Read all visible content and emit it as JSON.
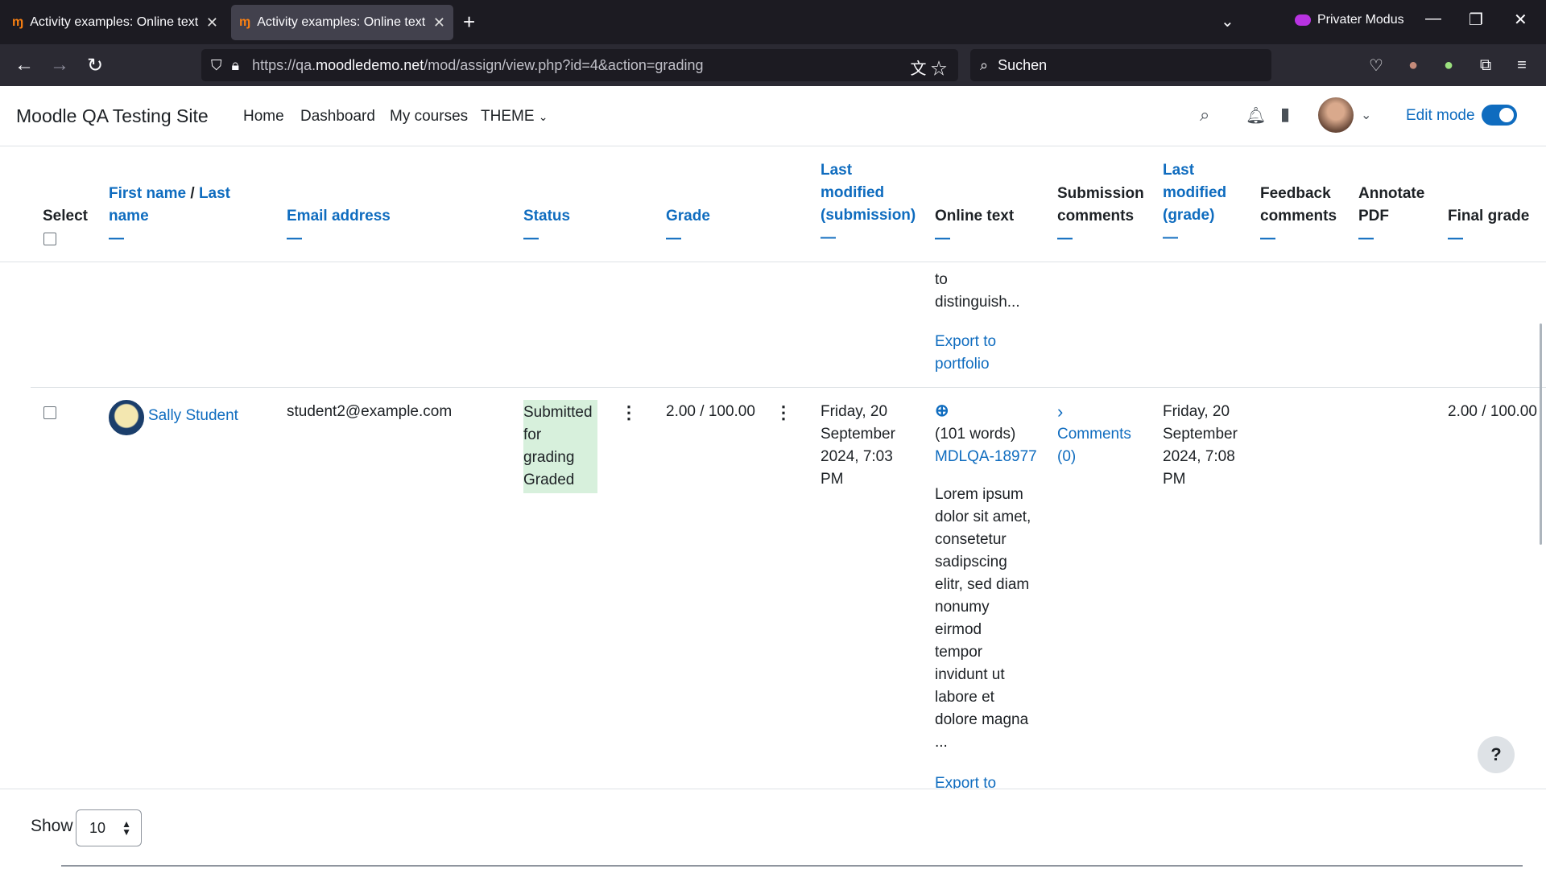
{
  "browser": {
    "tabs": [
      {
        "title": "Activity examples: Online text a",
        "active": false
      },
      {
        "title": "Activity examples: Online text a",
        "active": true
      }
    ],
    "new_tab": "+",
    "private_label": "Privater Modus",
    "url_prefix": "https://qa.",
    "url_domain": "moodledemo.net",
    "url_path": "/mod/assign/view.php?id=4&action=grading",
    "search_placeholder": "Suchen"
  },
  "moodle": {
    "site_name": "Moodle QA Testing Site",
    "nav": [
      "Home",
      "Dashboard",
      "My courses",
      "THEME"
    ],
    "edit_mode_label": "Edit mode",
    "edit_mode_on": true
  },
  "table": {
    "headers": {
      "select": "Select",
      "first_name": "First name",
      "separator": "/",
      "last_name_line1": "Last",
      "last_name_line2": "name",
      "email": "Email address",
      "status": "Status",
      "grade": "Grade",
      "last_modified_sub_1": "Last",
      "last_modified_sub_2": "modified",
      "last_modified_sub_3": "(submission)",
      "online_text": "Online text",
      "submission_comments_1": "Submission",
      "submission_comments_2": "comments",
      "last_modified_grade_1": "Last",
      "last_modified_grade_2": "modified",
      "last_modified_grade_3": "(grade)",
      "feedback_comments_1": "Feedback",
      "feedback_comments_2": "comments",
      "annotate_pdf_1": "Annotate",
      "annotate_pdf_2": "PDF",
      "final_grade": "Final grade",
      "collapse_symbol": "—"
    },
    "prev_row": {
      "online_text_tail": [
        "to",
        "distinguish..."
      ],
      "export_1": "Export to",
      "export_2": "portfolio"
    },
    "row": {
      "name": "Sally Student",
      "email": "student2@example.com",
      "status_lines": [
        "Submitted",
        "for",
        "grading",
        "Graded"
      ],
      "grade": "2.00 / 100.00",
      "last_modified_submission": [
        "Friday, 20",
        "September",
        "2024, 7:03",
        "PM"
      ],
      "word_count": "(101 words)",
      "attachment": "MDLQA-18977",
      "online_text_lines": [
        "Lorem ipsum",
        "dolor sit amet,",
        "consetetur",
        "sadipscing",
        "elitr, sed diam",
        "nonumy",
        "eirmod",
        "tempor",
        "invidunt ut",
        "labore et",
        "dolore magna",
        "..."
      ],
      "export_1": "Export to",
      "comments_1": "Comments",
      "comments_2": "(0)",
      "last_modified_grade": [
        "Friday, 20",
        "September",
        "2024, 7:08",
        "PM"
      ],
      "final_grade": "2.00 / 100.00"
    }
  },
  "footer": {
    "show_label": "Show",
    "per_page": "10"
  },
  "help_label": "?",
  "colors": {
    "link": "#0f6cbf",
    "status_bg": "#d7f0dc",
    "chrome_dark": "#1c1b22"
  }
}
